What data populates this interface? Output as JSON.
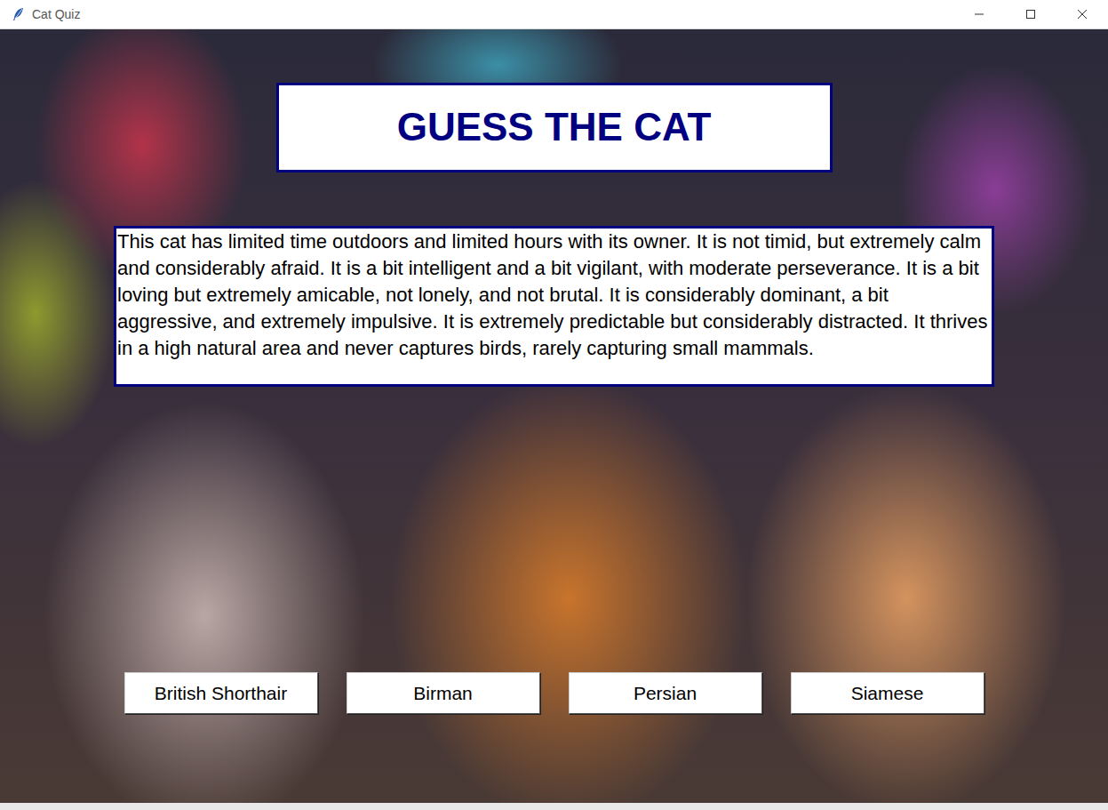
{
  "window": {
    "title": "Cat Quiz"
  },
  "heading": "GUESS THE CAT",
  "description": "This cat has limited time outdoors and limited hours with its owner. It is not timid, but extremely calm and considerably afraid. It is a bit intelligent and a bit vigilant, with moderate perseverance. It is a bit loving but extremely amicable, not lonely, and not brutal. It is considerably dominant, a bit aggressive, and extremely impulsive. It is extremely predictable but considerably distracted. It thrives in a high natural area and never captures birds, rarely capturing small mammals.",
  "answers": [
    "British Shorthair",
    "Birman",
    "Persian",
    "Siamese"
  ]
}
